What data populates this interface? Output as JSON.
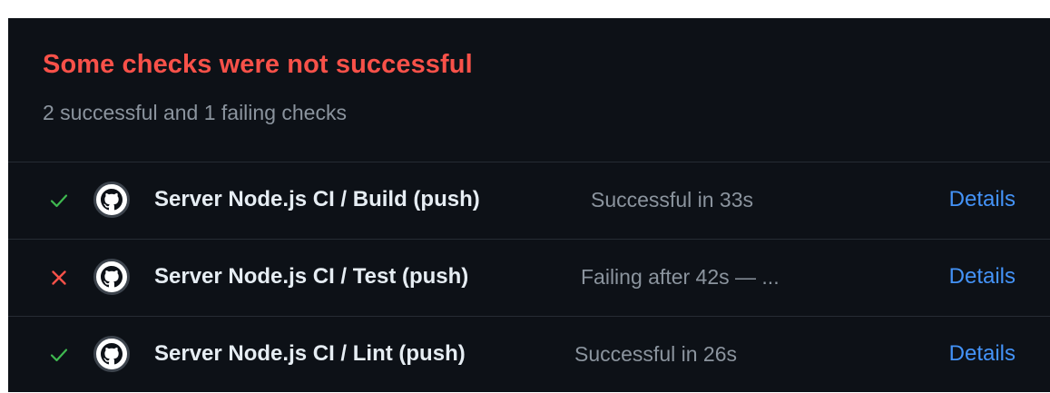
{
  "summary": {
    "title": "Some checks were not successful",
    "subtitle": "2 successful and 1 failing checks"
  },
  "colors": {
    "panel_bg": "#0d1117",
    "fail": "#f85149",
    "success": "#3fb950",
    "muted": "#8b949e",
    "link": "#4493f8",
    "text": "#e6edf3"
  },
  "checks": [
    {
      "status": "success",
      "status_icon": "check-icon",
      "avatar_icon": "github-icon",
      "name": "Server Node.js CI / Build (push)",
      "description": "Successful in 33s",
      "link_label": "Details"
    },
    {
      "status": "failure",
      "status_icon": "x-icon",
      "avatar_icon": "github-icon",
      "name": "Server Node.js CI / Test (push)",
      "description": "Failing after 42s — ...",
      "link_label": "Details"
    },
    {
      "status": "success",
      "status_icon": "check-icon",
      "avatar_icon": "github-icon",
      "name": "Server Node.js CI / Lint (push)",
      "description": "Successful in 26s",
      "link_label": "Details"
    }
  ]
}
